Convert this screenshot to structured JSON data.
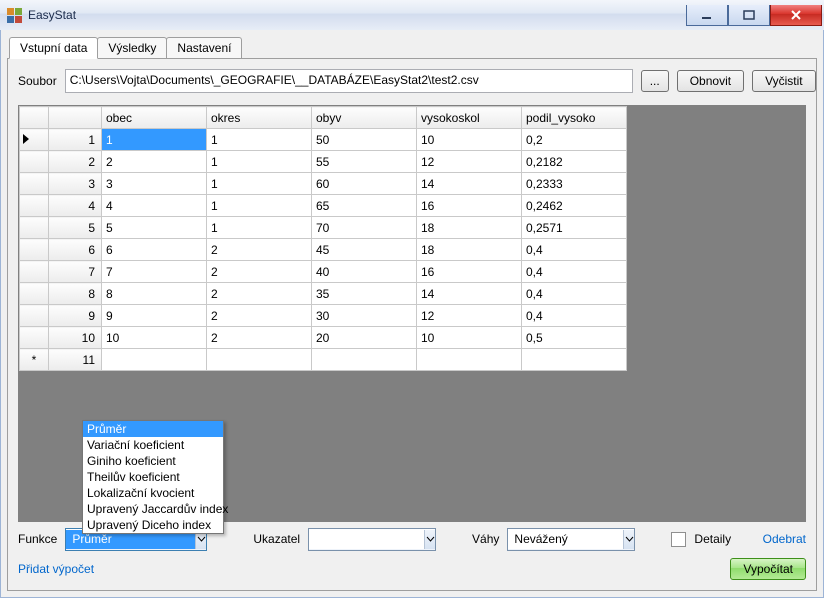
{
  "window": {
    "title": "EasyStat"
  },
  "tabs": [
    {
      "label": "Vstupní data",
      "active": true
    },
    {
      "label": "Výsledky",
      "active": false
    },
    {
      "label": "Nastavení",
      "active": false
    }
  ],
  "file": {
    "label": "Soubor",
    "path": "C:\\Users\\Vojta\\Documents\\_GEOGRAFIE\\__DATABÁZE\\EasyStat2\\test2.csv",
    "browse": "...",
    "refresh": "Obnovit",
    "clear": "Vyčistit"
  },
  "grid": {
    "columns": [
      "obec",
      "okres",
      "obyv",
      "vysokoskol",
      "podil_vysoko"
    ],
    "rows": [
      {
        "n": "1",
        "cells": [
          "1",
          "1",
          "50",
          "10",
          "0,2"
        ],
        "current": true
      },
      {
        "n": "2",
        "cells": [
          "2",
          "1",
          "55",
          "12",
          "0,2182"
        ]
      },
      {
        "n": "3",
        "cells": [
          "3",
          "1",
          "60",
          "14",
          "0,2333"
        ]
      },
      {
        "n": "4",
        "cells": [
          "4",
          "1",
          "65",
          "16",
          "0,2462"
        ]
      },
      {
        "n": "5",
        "cells": [
          "5",
          "1",
          "70",
          "18",
          "0,2571"
        ]
      },
      {
        "n": "6",
        "cells": [
          "6",
          "2",
          "45",
          "18",
          "0,4"
        ]
      },
      {
        "n": "7",
        "cells": [
          "7",
          "2",
          "40",
          "16",
          "0,4"
        ]
      },
      {
        "n": "8",
        "cells": [
          "8",
          "2",
          "35",
          "14",
          "0,4"
        ]
      },
      {
        "n": "9",
        "cells": [
          "9",
          "2",
          "30",
          "12",
          "0,4"
        ]
      },
      {
        "n": "10",
        "cells": [
          "10",
          "2",
          "20",
          "10",
          "0,5"
        ]
      }
    ],
    "newrow": "11"
  },
  "funkce": {
    "label": "Funkce",
    "selected": "Průměr",
    "options": [
      "Průměr",
      "Variační koeficient",
      "Giniho koeficient",
      "Theilův koeficient",
      "Lokalizační kvocient",
      "Upravený Jaccardův index",
      "Upravený Diceho index"
    ]
  },
  "ukazatel": {
    "label": "Ukazatel",
    "selected": ""
  },
  "vahy": {
    "label": "Váhy",
    "selected": "Nevážený"
  },
  "detaily": {
    "label": "Detaily",
    "checked": false
  },
  "links": {
    "odebrat": "Odebrat",
    "pridat": "Přidat výpočet"
  },
  "compute": "Vypočítat"
}
